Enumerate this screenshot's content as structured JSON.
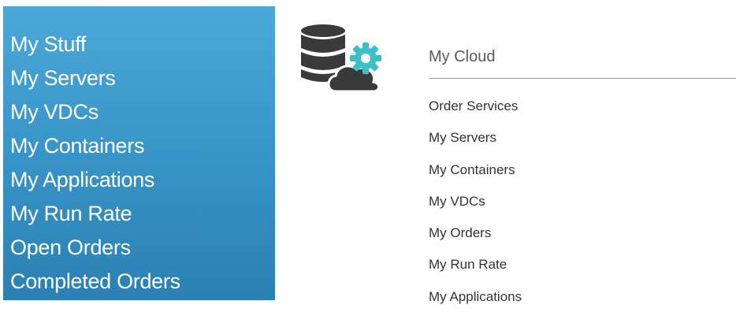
{
  "sidebar": {
    "items": [
      {
        "label": "My Stuff"
      },
      {
        "label": "My Servers"
      },
      {
        "label": "My VDCs"
      },
      {
        "label": "My Containers"
      },
      {
        "label": "My Applications"
      },
      {
        "label": "My Run Rate"
      },
      {
        "label": "Open Orders"
      },
      {
        "label": "Completed Orders"
      }
    ],
    "bg_top": "#4ba8d8",
    "bg_bottom": "#2b80b3"
  },
  "cloud": {
    "icon": "database-cloud-gear-icon",
    "title": "My Cloud",
    "links": [
      {
        "label": "Order Services"
      },
      {
        "label": "My Servers"
      },
      {
        "label": "My Containers"
      },
      {
        "label": "My VDCs"
      },
      {
        "label": "My Orders"
      },
      {
        "label": "My Run Rate"
      },
      {
        "label": "My Applications"
      }
    ],
    "icon_dark_color": "#3a3a3a",
    "icon_accent_color": "#3cc0c8"
  }
}
